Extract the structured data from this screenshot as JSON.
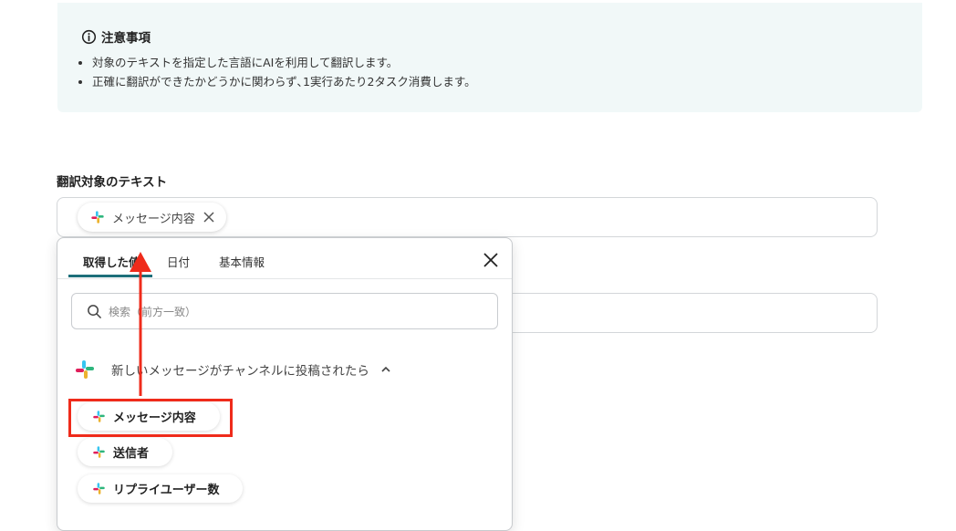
{
  "notice": {
    "title": "注意事項",
    "items": [
      "対象のテキストを指定した言語にAIを利用して翻訳します。",
      "正確に翻訳ができたかどうかに関わらず､1実行あたり2タスク消費します。"
    ]
  },
  "field": {
    "label": "翻訳対象のテキスト",
    "chip_label": "メッセージ内容"
  },
  "popup": {
    "tabs": [
      "取得した値",
      "日付",
      "基本情報"
    ],
    "active_tab": "取得した値",
    "search_placeholder": "検索（前方一致）",
    "section_title": "新しいメッセージがチャンネルに投稿されたら",
    "items": [
      "メッセージ内容",
      "送信者",
      "リプライユーザー数"
    ]
  },
  "colors": {
    "accent": "#1d6f7a",
    "highlight": "#ef2b1b",
    "notice_bg": "#f1f8f8"
  }
}
